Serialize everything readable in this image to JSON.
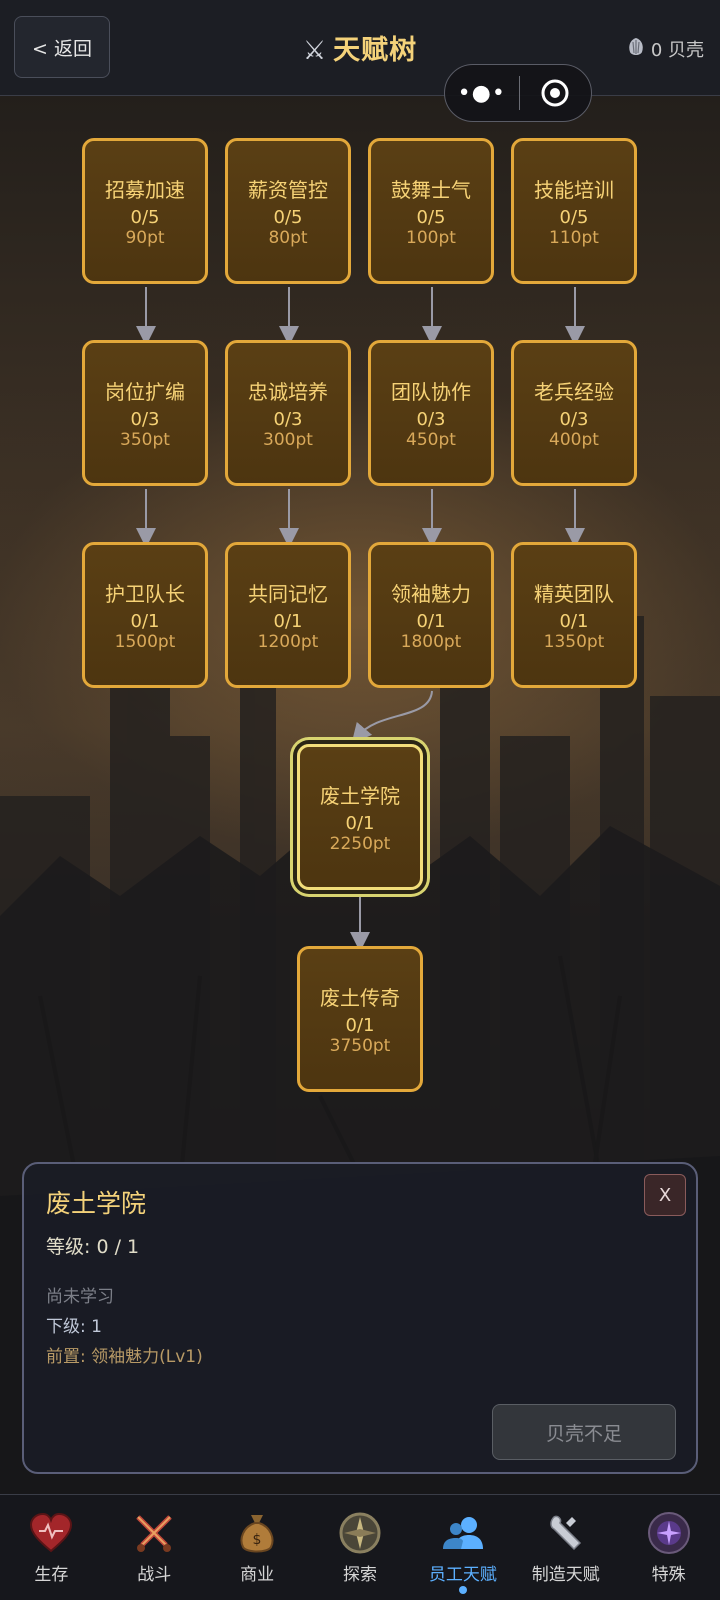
{
  "header": {
    "back_label": "< 返回",
    "title": "天赋树",
    "title_icon": "crossed-swords-icon",
    "shells_label": "0 贝壳",
    "shells_icon": "shell-icon"
  },
  "capsule": {
    "more_icon": "more-dots-icon",
    "close_icon": "target-icon"
  },
  "talents": [
    {
      "name": "招募加速",
      "level": "0/5",
      "cost": "90pt"
    },
    {
      "name": "薪资管控",
      "level": "0/5",
      "cost": "80pt"
    },
    {
      "name": "鼓舞士气",
      "level": "0/5",
      "cost": "100pt"
    },
    {
      "name": "技能培训",
      "level": "0/5",
      "cost": "110pt"
    },
    {
      "name": "岗位扩编",
      "level": "0/3",
      "cost": "350pt"
    },
    {
      "name": "忠诚培养",
      "level": "0/3",
      "cost": "300pt"
    },
    {
      "name": "团队协作",
      "level": "0/3",
      "cost": "450pt"
    },
    {
      "name": "老兵经验",
      "level": "0/3",
      "cost": "400pt"
    },
    {
      "name": "护卫队长",
      "level": "0/1",
      "cost": "1500pt"
    },
    {
      "name": "共同记忆",
      "level": "0/1",
      "cost": "1200pt"
    },
    {
      "name": "领袖魅力",
      "level": "0/1",
      "cost": "1800pt"
    },
    {
      "name": "精英团队",
      "level": "0/1",
      "cost": "1350pt"
    },
    {
      "name": "废土学院",
      "level": "0/1",
      "cost": "2250pt"
    },
    {
      "name": "废土传奇",
      "level": "0/1",
      "cost": "3750pt"
    }
  ],
  "detail": {
    "title": "废土学院",
    "level": "等级: 0 / 1",
    "status": "尚未学习",
    "next": "下级: 1",
    "prereq": "前置: 领袖魅力(Lv1)",
    "close_label": "X",
    "action_label": "贝壳不足"
  },
  "tabs": [
    {
      "label": "生存",
      "icon": "heart-icon"
    },
    {
      "label": "战斗",
      "icon": "crossed-swords-icon"
    },
    {
      "label": "商业",
      "icon": "money-bag-icon"
    },
    {
      "label": "探索",
      "icon": "compass-icon"
    },
    {
      "label": "员工天赋",
      "icon": "staff-icon"
    },
    {
      "label": "制造天赋",
      "icon": "wrench-icon"
    },
    {
      "label": "特殊",
      "icon": "special-icon"
    }
  ],
  "colors": {
    "node_border": "#e3a83a",
    "node_fill": "#4d3510",
    "gold_text": "#f4d27a",
    "active_tab": "#5cb0ff"
  }
}
